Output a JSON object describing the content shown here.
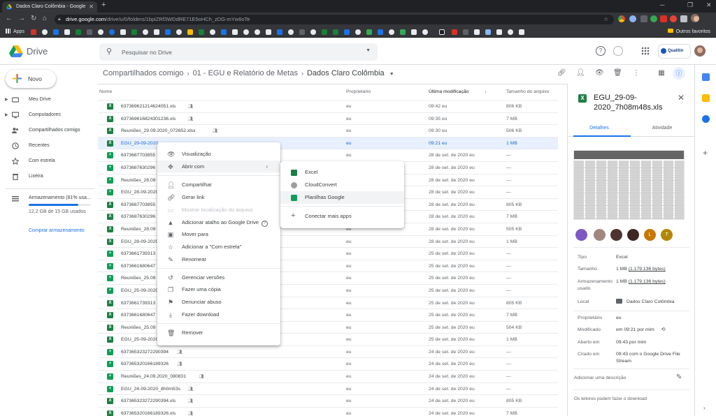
{
  "browser": {
    "tab_title": "Dados Claro Colômbia - Google",
    "url_host": "drive.google.com",
    "url_path": "/drive/u/0/folders/1bpiZRf3WDdRE71E5oHCh_zDG-mYw6oTe",
    "bookmarks_apps": "Apps",
    "bookmarks_other": "Outros favoritos"
  },
  "drive": {
    "logo_text": "Drive",
    "search_placeholder": "Pesquisar no Drive",
    "account_brand": "Qualitin"
  },
  "nav": {
    "new_label": "Novo",
    "items": [
      {
        "label": "Meu Drive",
        "icon": "drive-icon"
      },
      {
        "label": "Computadores",
        "icon": "computer-icon"
      },
      {
        "label": "Compartilhados comigo",
        "icon": "shared-icon"
      },
      {
        "label": "Recentes",
        "icon": "clock-icon"
      },
      {
        "label": "Com estrela",
        "icon": "star-icon"
      },
      {
        "label": "Lixeira",
        "icon": "trash-icon"
      }
    ],
    "storage_label": "Armazenamento (81% usa...",
    "storage_used": "12,2 GB de 15 GB usados",
    "storage_fraction": 0.81,
    "buy_storage": "Comprar armazenamento"
  },
  "breadcrumb": [
    "Compartilhados comigo",
    "01 - EGU e Relatório de Metas",
    "Dados Claro Colômbia"
  ],
  "list": {
    "headers": {
      "name": "Nome",
      "owner": "Proprietário",
      "modified": "Última modificação",
      "size": "Tamanho do arquivo"
    },
    "rows": [
      {
        "name": "637369621214624051.xls",
        "shared": true,
        "type": "xls",
        "owner": "eu",
        "modified": "09:42 eu",
        "size": "806 KB"
      },
      {
        "name": "637369616824301236.xls",
        "shared": true,
        "type": "xls",
        "owner": "eu",
        "modified": "09:35 eu",
        "size": "7 MB"
      },
      {
        "name": "Reuniões_29.09.2020_072652.xlsx",
        "shared": true,
        "type": "xls",
        "owner": "eu",
        "modified": "09:30 eu",
        "size": "506 KB"
      },
      {
        "name": "EGU_29-09-2020",
        "shared": false,
        "type": "xls",
        "owner": "eu",
        "modified": "09:21 eu",
        "size": "1 MB",
        "selected": true
      },
      {
        "name": "6373687703855",
        "shared": false,
        "type": "sheet",
        "owner": "eu",
        "modified": "28 de set. de 2020 eu",
        "size": "—"
      },
      {
        "name": "6373687630296",
        "shared": false,
        "type": "sheet",
        "owner": "eu",
        "modified": "28 de set. de 2020 eu",
        "size": "—"
      },
      {
        "name": "Reuniões_28.09",
        "shared": false,
        "type": "sheet",
        "owner": "eu",
        "modified": "28 de set. de 2020 eu",
        "size": "—"
      },
      {
        "name": "EGU_28-09-2020",
        "shared": false,
        "type": "sheet",
        "owner": "eu",
        "modified": "28 de set. de 2020 eu",
        "size": "—"
      },
      {
        "name": "6373687703855",
        "shared": false,
        "type": "xls",
        "owner": "eu",
        "modified": "28 de set. de 2020 eu",
        "size": "805 KB"
      },
      {
        "name": "6373687630296",
        "shared": false,
        "type": "xls",
        "owner": "eu",
        "modified": "28 de set. de 2020 eu",
        "size": "7 MB"
      },
      {
        "name": "Reuniões_28.09",
        "shared": false,
        "type": "xls",
        "owner": "eu",
        "modified": "28 de set. de 2020 eu",
        "size": "505 KB"
      },
      {
        "name": "EGU_28-09-2020",
        "shared": false,
        "type": "xls",
        "owner": "eu",
        "modified": "28 de set. de 2020 eu",
        "size": "1 MB"
      },
      {
        "name": "6373661739313",
        "shared": false,
        "type": "sheet",
        "owner": "eu",
        "modified": "25 de set. de 2020 eu",
        "size": "—"
      },
      {
        "name": "6373661680647",
        "shared": false,
        "type": "sheet",
        "owner": "eu",
        "modified": "25 de set. de 2020 eu",
        "size": "—"
      },
      {
        "name": "Reuniões_25.09",
        "shared": false,
        "type": "sheet",
        "owner": "eu",
        "modified": "25 de set. de 2020 eu",
        "size": "—"
      },
      {
        "name": "EGU_25-09-2020",
        "shared": false,
        "type": "sheet",
        "owner": "eu",
        "modified": "25 de set. de 2020 eu",
        "size": "—"
      },
      {
        "name": "6373661739313",
        "shared": false,
        "type": "xls",
        "owner": "eu",
        "modified": "25 de set. de 2020 eu",
        "size": "805 KB"
      },
      {
        "name": "6373661680647",
        "shared": false,
        "type": "xls",
        "owner": "eu",
        "modified": "25 de set. de 2020 eu",
        "size": "7 MB"
      },
      {
        "name": "Reuniões_25.09",
        "shared": false,
        "type": "xls",
        "owner": "eu",
        "modified": "25 de set. de 2020 eu",
        "size": "504 KB"
      },
      {
        "name": "EGU_25-09-2020",
        "shared": false,
        "type": "xls",
        "owner": "eu",
        "modified": "25 de set. de 2020 eu",
        "size": "1 MB"
      },
      {
        "name": "637365323272290394",
        "shared": true,
        "type": "sheet",
        "owner": "eu",
        "modified": "24 de set. de 2020 eu",
        "size": "—"
      },
      {
        "name": "637365320166189326",
        "shared": true,
        "type": "sheet",
        "owner": "eu",
        "modified": "24 de set. de 2020 eu",
        "size": "—"
      },
      {
        "name": "Reuniões_24.09.2020_080831",
        "shared": true,
        "type": "sheet",
        "owner": "eu",
        "modified": "24 de set. de 2020 eu",
        "size": "—"
      },
      {
        "name": "EGU_24-09-2020_8h0m53s",
        "shared": true,
        "type": "sheet",
        "owner": "eu",
        "modified": "24 de set. de 2020 eu",
        "size": "—"
      },
      {
        "name": "637365323272290394.xls",
        "shared": true,
        "type": "xls",
        "owner": "eu",
        "modified": "24 de set. de 2020 eu",
        "size": "805 KB"
      },
      {
        "name": "637365320166189326.xls",
        "shared": true,
        "type": "xls",
        "owner": "eu",
        "modified": "24 de set. de 2020 eu",
        "size": "7 MB"
      }
    ]
  },
  "context_menu": {
    "items": [
      {
        "label": "Visualização",
        "icon": "eye-icon"
      },
      {
        "label": "Abrir com",
        "icon": "open-with-icon",
        "submenu": true
      },
      {
        "label": "Compartilhar",
        "icon": "share-icon"
      },
      {
        "label": "Gerar link",
        "icon": "link-icon"
      },
      {
        "label": "Mostrar localização do arquivo",
        "icon": "folder-icon",
        "disabled": true
      },
      {
        "label": "Adicionar atalho ao Google Drive",
        "icon": "shortcut-icon",
        "help": "?"
      },
      {
        "label": "Mover para",
        "icon": "move-icon"
      },
      {
        "label": "Adicionar a \"Com estrela\"",
        "icon": "star-icon"
      },
      {
        "label": "Renomear",
        "icon": "pencil-icon"
      },
      {
        "label": "Gerenciar versões",
        "icon": "history-icon"
      },
      {
        "label": "Fazer uma cópia",
        "icon": "copy-icon"
      },
      {
        "label": "Denunciar abuso",
        "icon": "report-icon"
      },
      {
        "label": "Fazer download",
        "icon": "download-icon"
      },
      {
        "label": "Remover",
        "icon": "trash-icon"
      }
    ],
    "submenu": [
      {
        "label": "Excel",
        "color": "#1e7e45"
      },
      {
        "label": "CloudConvert",
        "color": "#9e9e9e"
      },
      {
        "label": "Planilhas Google",
        "color": "#0f9d58"
      },
      {
        "label": "Conectar mais apps",
        "icon": "plus-icon"
      }
    ]
  },
  "details": {
    "title": "EGU_29-09-2020_7h08m48s.xls",
    "tab_details": "Detalhes",
    "tab_activity": "Atividade",
    "avatar_letters": [
      "L",
      "T"
    ],
    "rows": [
      {
        "label": "Tipo",
        "value": "Excel"
      },
      {
        "label": "Tamanho",
        "value": "1 MB",
        "value_extra": "(1.179.136 bytes)"
      },
      {
        "label": "Armazenamento usado",
        "value": "1 MB",
        "value_extra": "(1.179.136 bytes)"
      },
      {
        "label": "Local",
        "value": "Dados Claro Colômbia"
      },
      {
        "label": "Proprietário",
        "value": "eu"
      },
      {
        "label": "Modificado",
        "value": "em 09:21 por mim"
      },
      {
        "label": "Aberto em",
        "value": "09:43 por mim"
      },
      {
        "label": "Criado em",
        "value": "09:43 com o Google Drive File Stream"
      }
    ],
    "add_description": "Adicionar uma descrição",
    "readers_note": "Os leitores podem fazer o download"
  }
}
